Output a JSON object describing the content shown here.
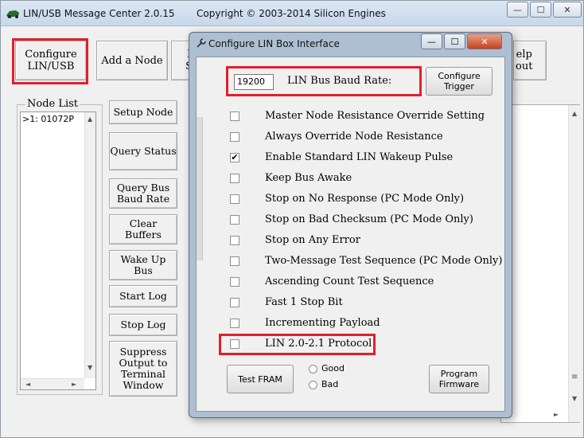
{
  "app": {
    "title": "LIN/USB Message Center 2.0.15",
    "copyright": "Copyright © 2003-2014 Silicon Engines",
    "minimize": "—",
    "maximize": "☐",
    "close": "✕"
  },
  "toolbar": {
    "configure_lin_usb": "Configure\nLIN/USB",
    "add_node": "Add a Node",
    "partial_left": "I\nS",
    "help_about": "elp\nout"
  },
  "node_list": {
    "legend": "Node List",
    "items": [
      ">1: 01072P"
    ]
  },
  "side_buttons": {
    "setup_node": "Setup Node",
    "query_status": "Query Status",
    "query_bus_baud_rate": "Query Bus\nBaud Rate",
    "clear_buffers": "Clear\nBuffers",
    "wake_up_bus": "Wake Up\nBus",
    "start_log": "Start Log",
    "stop_log": "Stop Log",
    "suppress_output": "Suppress\nOutput to\nTerminal\nWindow"
  },
  "dialog": {
    "title": "Configure LIN Box Interface",
    "minimize": "—",
    "maximize": "☐",
    "close": "✕",
    "baud_value": "19200",
    "baud_label": "LIN Bus Baud Rate:",
    "configure_trigger": "Configure\nTrigger",
    "options": [
      {
        "label": "Master Node Resistance Override Setting",
        "checked": false
      },
      {
        "label": "Always Override Node Resistance",
        "checked": false
      },
      {
        "label": "Enable Standard LIN Wakeup Pulse",
        "checked": true
      },
      {
        "label": "Keep Bus Awake",
        "checked": false
      },
      {
        "label": "Stop on No Response (PC Mode Only)",
        "checked": false
      },
      {
        "label": "Stop on Bad Checksum (PC Mode Only)",
        "checked": false
      },
      {
        "label": "Stop on Any Error",
        "checked": false
      },
      {
        "label": "Two-Message Test Sequence (PC Mode Only)",
        "checked": false
      },
      {
        "label": "Ascending Count Test Sequence",
        "checked": false
      },
      {
        "label": "Fast 1 Stop Bit",
        "checked": false
      },
      {
        "label": "Incrementing Payload",
        "checked": false
      },
      {
        "label": "LIN 2.0-2.1 Protocol",
        "checked": false
      }
    ],
    "test_fram": "Test FRAM",
    "radio_good": "Good",
    "radio_bad": "Bad",
    "program_firmware": "Program\nFirmware"
  },
  "colors": {
    "highlight": "#e0202a",
    "dialog_frame": "#aebfd3"
  }
}
